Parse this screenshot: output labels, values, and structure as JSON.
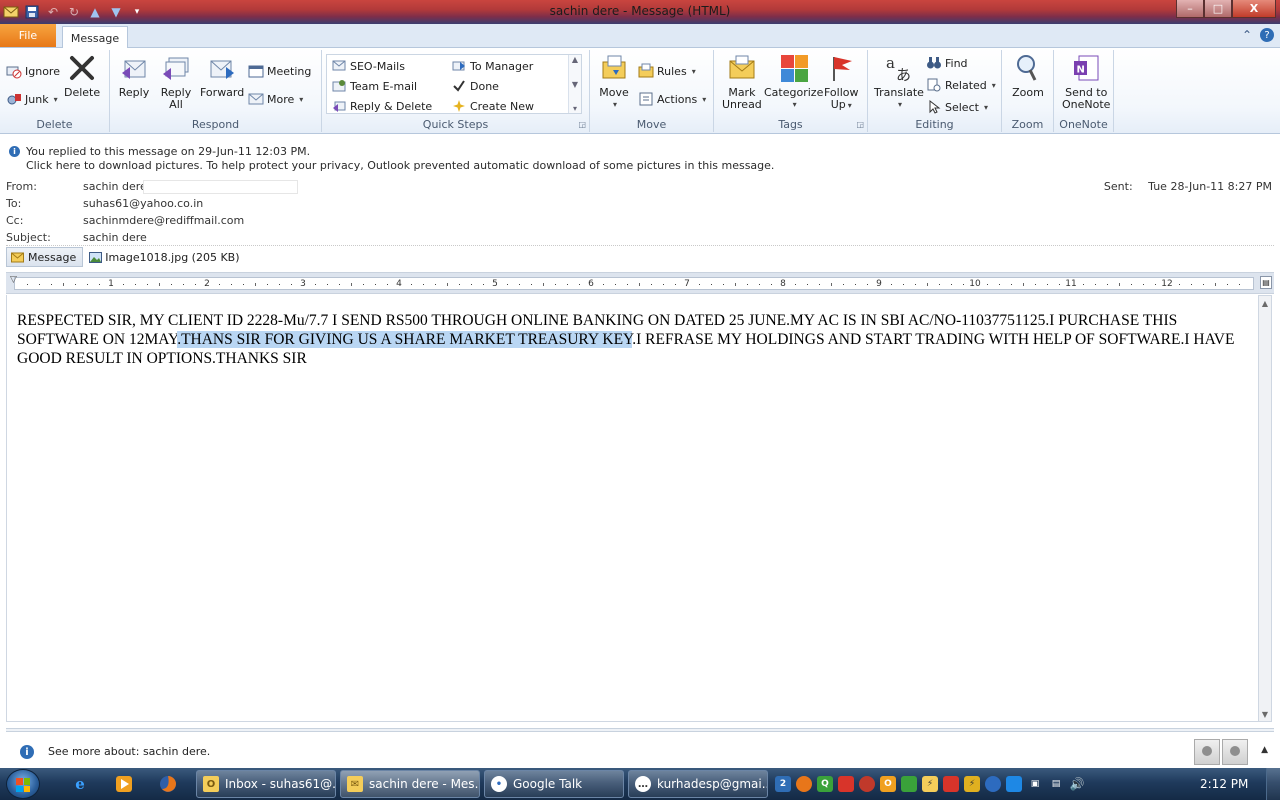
{
  "window": {
    "title": "sachin dere  -  Message (HTML)",
    "controls": [
      "–",
      "□",
      "X"
    ]
  },
  "tabs": {
    "file": "File",
    "message": "Message"
  },
  "ribbon": {
    "delete": {
      "label": "Delete",
      "ignore": "Ignore",
      "junk": "Junk",
      "delete": "Delete"
    },
    "respond": {
      "label": "Respond",
      "reply": "Reply",
      "reply_all_1": "Reply",
      "reply_all_2": "All",
      "forward": "Forward",
      "meeting": "Meeting",
      "more": "More"
    },
    "quick_steps": {
      "label": "Quick Steps",
      "items": [
        "SEO-Mails",
        "To Manager",
        "Team E-mail",
        "Done",
        "Reply & Delete",
        "Create New"
      ]
    },
    "move": {
      "label": "Move",
      "move": "Move",
      "rules": "Rules",
      "actions": "Actions"
    },
    "tags": {
      "label": "Tags",
      "mark_unread_1": "Mark",
      "mark_unread_2": "Unread",
      "categorize": "Categorize",
      "follow_up_1": "Follow",
      "follow_up_2": "Up"
    },
    "editing": {
      "label": "Editing",
      "translate": "Translate",
      "find": "Find",
      "related": "Related",
      "select": "Select"
    },
    "zoom": {
      "label": "Zoom",
      "zoom": "Zoom"
    },
    "onenote": {
      "label": "OneNote",
      "send_1": "Send to",
      "send_2": "OneNote"
    }
  },
  "infobar": {
    "replied": "You replied to this message on 29-Jun-11 12:03 PM.",
    "pictures": "Click here to download pictures. To help protect your privacy, Outlook prevented automatic download of some pictures in this message."
  },
  "header": {
    "from_label": "From:",
    "from": "sachin dere",
    "to_label": "To:",
    "to": "suhas61@yahoo.co.in",
    "cc_label": "Cc:",
    "cc": "sachinmdere@rediffmail.com",
    "subject_label": "Subject:",
    "subject": "sachin dere",
    "sent_label": "Sent:",
    "sent": "Tue 28-Jun-11 8:27 PM"
  },
  "attachments": {
    "message_tab": "Message",
    "file": "Image1018.jpg (205 KB)"
  },
  "ruler": {
    "numbers": [
      "1",
      "2",
      "3",
      "4",
      "5",
      "6",
      "7",
      "8",
      "9",
      "10",
      "11",
      "12"
    ]
  },
  "body": {
    "part1": "RESPECTED SIR, MY CLIENT ID 2228-Mu/7.7 I SEND RS500 THROUGH ONLINE BANKING ON DATED 25 JUNE.MY AC IS IN SBI AC/NO-11037751125.I PURCHASE THIS SOFTWARE ON 12MAY",
    "highlight": ".THANS SIR FOR GIVING US A SHARE MARKET TREASURY KEY",
    "part2": ".I REFRASE MY HOLDINGS AND START TRADING WITH HELP OF SOFTWARE.I HAVE GOOD RESULT IN OPTIONS.THANKS SIR"
  },
  "people_pane": {
    "text": "See more about: sachin dere."
  },
  "taskbar": {
    "tasks": [
      "Inbox - suhas61@...",
      "sachin dere - Mes...",
      "Google Talk",
      "kurhadesp@gmai..."
    ],
    "clock": "2:12 PM"
  },
  "colors": {
    "accent_file_tab": "#e77817",
    "highlight": "#b9d6f3",
    "titlebar": "#b23a3a"
  }
}
